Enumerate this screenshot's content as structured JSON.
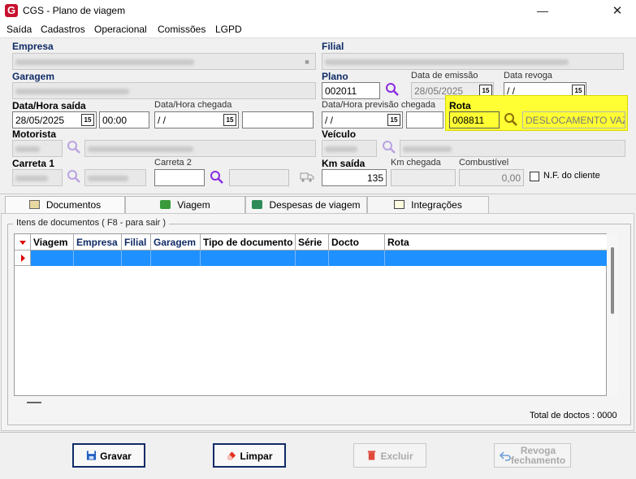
{
  "window": {
    "title": "CGS - Plano de viagem"
  },
  "menu": [
    "Saída",
    "Cadastros",
    "Operacional",
    "Comissões",
    "LGPD"
  ],
  "form": {
    "empresa_label": "Empresa",
    "filial_label": "Filial",
    "garagem_label": "Garagem",
    "plano_label": "Plano",
    "plano_value": "002011",
    "data_emissao_label": "Data de emissão",
    "data_emissao_value": "28/05/2025",
    "data_revoga_label": "Data revoga",
    "data_revoga_value": " / /",
    "data_hora_saida_label": "Data/Hora saída",
    "data_saida_value": "28/05/2025",
    "hora_saida_value": "00:00",
    "data_hora_chegada_label": "Data/Hora chegada",
    "data_chegada_value": " / /",
    "previsao_chegada_label": "Data/Hora previsão chegada",
    "previsao_chegada_value": " / /",
    "rota_label": "Rota",
    "rota_code": "008811",
    "rota_desc": "DESLOCAMENTO VAZIO",
    "motorista_label": "Motorista",
    "veiculo_label": "Veículo",
    "carreta1_label": "Carreta 1",
    "carreta2_label": "Carreta 2",
    "km_saida_label": "Km saída",
    "km_saida_value": "135",
    "km_chegada_label": "Km chegada",
    "combustivel_label": "Combustível",
    "combustivel_value": "0,00",
    "nf_cliente_label": "N.F. do cliente",
    "calendar_glyph": "15"
  },
  "tabs": [
    "Documentos",
    "Viagem",
    "Despesas de viagem",
    "Integrações"
  ],
  "documentos": {
    "group_title": "Itens de documentos ( F8 - para sair )",
    "columns": [
      "Viagem",
      "Empresa",
      "Filial",
      "Garagem",
      "Tipo de documento",
      "Série",
      "Docto",
      "Rota"
    ],
    "total_text": "Total de doctos : 0000"
  },
  "buttons": {
    "gravar": "Gravar",
    "limpar": "Limpar",
    "excluir": "Excluir",
    "revoga_line1": "Revoga",
    "revoga_line2": "fechamento"
  },
  "colors": {
    "accent": "#0f2b66",
    "highlight": "#ffff33",
    "selection": "#1e90ff",
    "brand": "#c8102e"
  },
  "icons": [
    "app-logo-icon",
    "minimize-icon",
    "close-icon",
    "search-icon",
    "calendar-icon",
    "truck-icon",
    "save-icon",
    "eraser-icon",
    "trash-icon",
    "undo-icon",
    "sort-arrow-icon",
    "row-pointer-icon"
  ]
}
